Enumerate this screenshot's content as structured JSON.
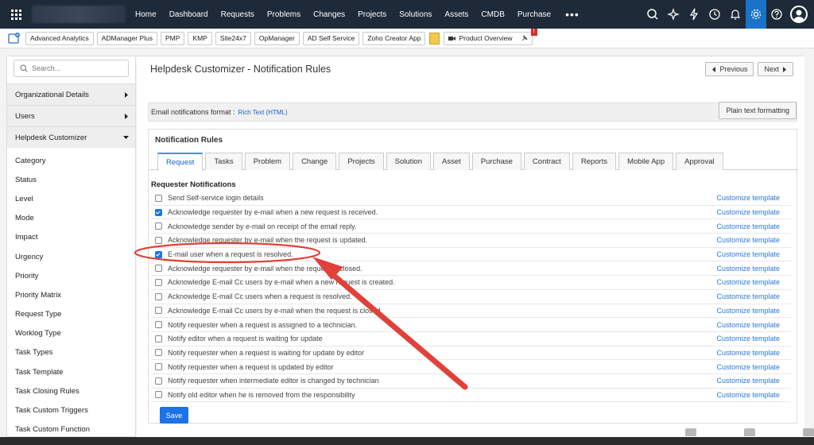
{
  "topnav": {
    "items": [
      "Home",
      "Dashboard",
      "Requests",
      "Problems",
      "Changes",
      "Projects",
      "Solutions",
      "Assets",
      "CMDB",
      "Purchase"
    ],
    "more": "•••",
    "icons": [
      "search-icon",
      "ai-sparkle-icon",
      "lightning-icon",
      "history-icon",
      "bell-icon",
      "gear-icon",
      "help-icon",
      "user-avatar-icon"
    ]
  },
  "appbar": {
    "apps": [
      "Advanced Analytics",
      "ADManager Plus",
      "PMP",
      "KMP",
      "Site24x7",
      "OpManager",
      "AD Self Service",
      "Zoho Creator App"
    ],
    "product_overview": "Product Overview",
    "badge": "!"
  },
  "sidebar": {
    "search_placeholder": "Search...",
    "groups": [
      "Organizational Details",
      "Users",
      "Helpdesk Customizer"
    ],
    "items": [
      "Category",
      "Status",
      "Level",
      "Mode",
      "Impact",
      "Urgency",
      "Priority",
      "Priority Matrix",
      "Request Type",
      "Worklog Type",
      "Task Types",
      "Task Template",
      "Task Closing Rules",
      "Task Custom Triggers",
      "Task Custom Function"
    ]
  },
  "main": {
    "title": "Helpdesk Customizer - Notification Rules",
    "previous": "Previous",
    "next": "Next",
    "email_format_label": "Email notifications format :",
    "email_format_value": "Rich Text (HTML)",
    "plain_text_button": "Plain text formatting",
    "rules_title": "Notification Rules",
    "tabs": [
      "Request",
      "Tasks",
      "Problem",
      "Change",
      "Projects",
      "Solution",
      "Asset",
      "Purchase",
      "Contract",
      "Reports",
      "Mobile App",
      "Approval"
    ],
    "active_tab": "Request",
    "section_heading": "Requester Notifications",
    "customize_label": "Customize template",
    "rules": [
      {
        "text": "Send Self-service login details",
        "checked": false
      },
      {
        "text": "Acknowledge requester by e-mail when a new request is received.",
        "checked": true
      },
      {
        "text": "Acknowledge sender by e-mail on receipt of the email reply.",
        "checked": false
      },
      {
        "text": "Acknowledge requester by e-mail when the request is updated.",
        "checked": false
      },
      {
        "text": "E-mail user when a request is resolved.",
        "checked": true
      },
      {
        "text": "Acknowledge requester by e-mail when the request is closed.",
        "checked": false
      },
      {
        "text": "Acknowledge E-mail Cc users by e-mail when a new request is created.",
        "checked": false
      },
      {
        "text": "Acknowledge E-mail Cc users when a request is resolved.",
        "checked": false
      },
      {
        "text": "Acknowledge E-mail Cc users by e-mail when the request is closed.",
        "checked": false
      },
      {
        "text": "Notify requester when a request is assigned to a technician.",
        "checked": false
      },
      {
        "text": "Notify editor when a request is waiting for update",
        "checked": false
      },
      {
        "text": "Notify requester when a request is waiting for update by editor",
        "checked": false
      },
      {
        "text": "Notify requester when a request is updated by editor",
        "checked": false
      },
      {
        "text": "Notify requester when intermediate editor is changed by technician",
        "checked": false
      },
      {
        "text": "Notify old editor when he is removed from the responsibility",
        "checked": false
      }
    ],
    "save_label": "Save"
  },
  "colors": {
    "nav_bg": "#1e2a38",
    "accent": "#1a73e8",
    "annotation": "#e0413a"
  }
}
